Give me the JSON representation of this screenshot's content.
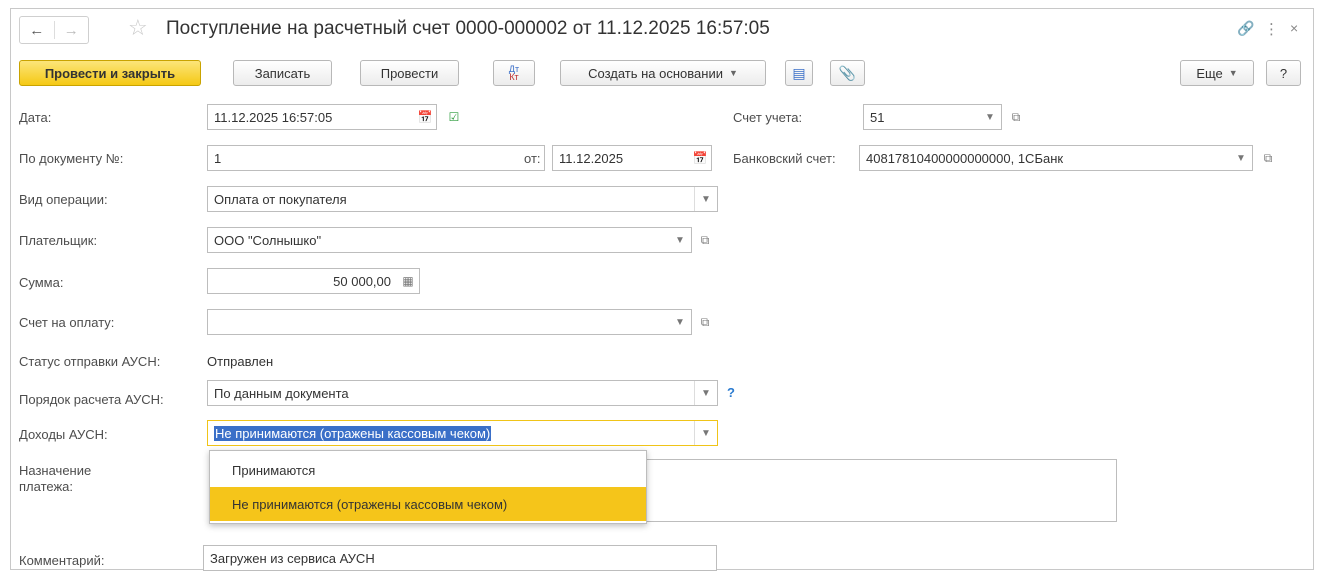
{
  "window": {
    "title": "Поступление на расчетный счет 0000-000002 от 11.12.2025 16:57:05",
    "back_icon": "arrow-left-icon",
    "forward_icon": "arrow-right-icon",
    "favorite_icon": "star-icon",
    "link_icon": "link-icon",
    "menu_icon": "more-vertical-icon",
    "close_icon": "close-icon"
  },
  "toolbar": {
    "post_and_close": "Провести и закрыть",
    "save": "Записать",
    "post": "Провести",
    "dtkt_top": "Дт",
    "dtkt_bottom": "Кт",
    "create_based": "Создать на основании",
    "more": "Еще",
    "help": "?"
  },
  "form": {
    "date": {
      "label": "Дата:",
      "value": "11.12.2025 16:57:05"
    },
    "doc_number": {
      "label": "По документу №:",
      "value": "1",
      "from_label": "от:",
      "from_value": "11.12.2025"
    },
    "operation": {
      "label": "Вид операции:",
      "value": "Оплата от покупателя"
    },
    "payer": {
      "label": "Плательщик:",
      "value": "ООО \"Солнышко\""
    },
    "amount": {
      "label": "Сумма:",
      "value": "50 000,00"
    },
    "invoice": {
      "label": "Счет на оплату:",
      "value": ""
    },
    "ausn_status": {
      "label": "Статус отправки АУСН:",
      "value": "Отправлен"
    },
    "ausn_calc": {
      "label": "Порядок расчета АУСН:",
      "value": "По данным документа",
      "help": "?"
    },
    "ausn_income": {
      "label": "Доходы АУСН:",
      "value": "Не принимаются (отражены кассовым чеком)"
    },
    "purpose": {
      "label_line1": "Назначение",
      "label_line2": "платежа:"
    },
    "comment": {
      "label": "Комментарий:",
      "value": "Загружен из сервиса АУСН"
    },
    "account": {
      "label": "Счет учета:",
      "value": "51"
    },
    "bank_account": {
      "label": "Банковский счет:",
      "value": "40817810400000000000, 1СБанк"
    }
  },
  "dropdown": {
    "items": [
      "Принимаются",
      "Не принимаются (отражены кассовым чеком)"
    ],
    "selected_index": 1
  },
  "colors": {
    "primary_button": "#f5c915",
    "dropdown_highlight": "#f5c51a",
    "selection": "#3a6fc8",
    "focus_border": "#f0c418"
  }
}
